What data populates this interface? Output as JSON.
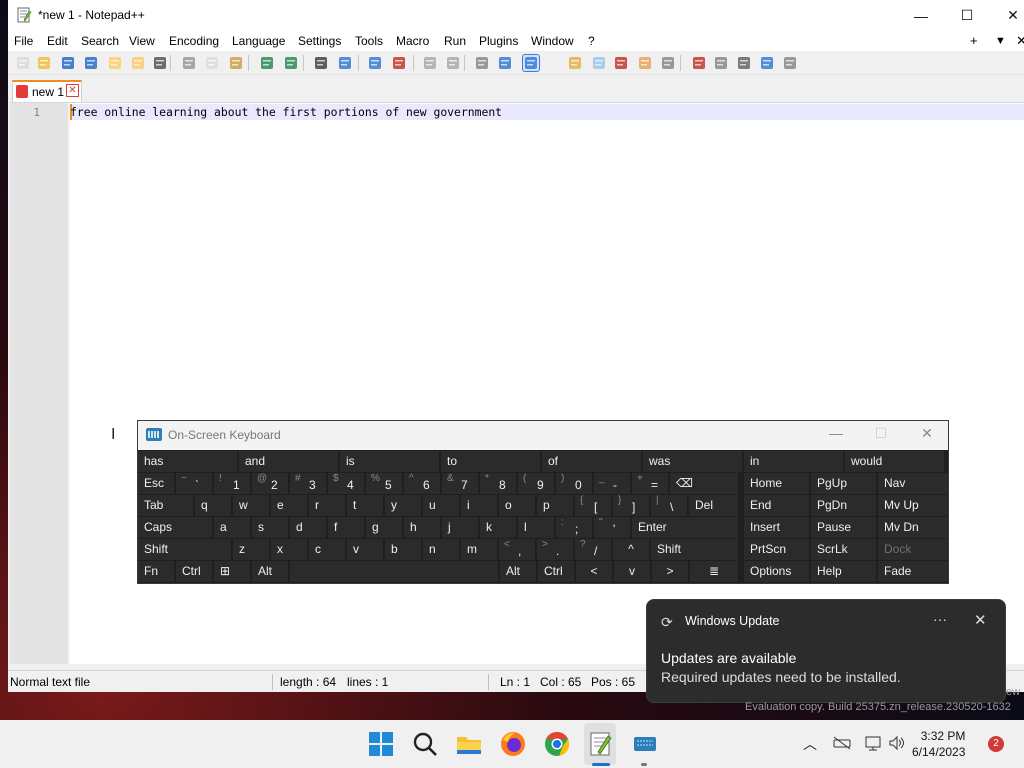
{
  "window": {
    "title": "*new 1 - Notepad++",
    "minimize": "—",
    "maximize": "☐",
    "close": "✕"
  },
  "menubar": {
    "items": [
      "File",
      "Edit",
      "Search",
      "View",
      "Encoding",
      "Language",
      "Settings",
      "Tools",
      "Macro",
      "Run",
      "Plugins",
      "Window",
      "?"
    ],
    "right_controls": [
      "+",
      "▼",
      "✕"
    ]
  },
  "toolbar": {
    "icons": [
      "new-file-icon",
      "open-file-icon",
      "save-icon",
      "save-all-icon",
      "close-icon",
      "close-all-icon",
      "print-icon",
      "cut-icon",
      "copy-icon",
      "paste-icon",
      "undo-icon",
      "redo-icon",
      "find-icon",
      "replace-icon",
      "zoom-in-icon",
      "zoom-out-icon",
      "sync-vertical-icon",
      "sync-horizontal-icon",
      "word-wrap-icon",
      "show-all-chars-icon",
      "indent-guide-icon",
      "udl-icon",
      "doc-map-icon",
      "function-list-icon",
      "folder-workspace-icon",
      "monitoring-icon",
      "record-macro-icon",
      "stop-macro-icon",
      "play-macro-icon",
      "run-macro-multiple-icon",
      "save-macro-icon"
    ]
  },
  "tab": {
    "label": "new 1",
    "close": "✕"
  },
  "editor": {
    "line_number": "1",
    "text": "free online learning about the first portions of new government"
  },
  "statusbar": {
    "file_type": "Normal text file",
    "length": "length : 64",
    "lines": "lines : 1",
    "ln": "Ln : 1",
    "col": "Col : 65",
    "pos": "Pos : 65"
  },
  "osk": {
    "title": "On-Screen Keyboard",
    "suggestions": [
      "has",
      "and",
      "is",
      "to",
      "of",
      "was",
      "in",
      "would"
    ],
    "row1": [
      {
        "label": "Esc"
      },
      {
        "shift": "~",
        "main": "`"
      },
      {
        "shift": "!",
        "main": "1"
      },
      {
        "shift": "@",
        "main": "2"
      },
      {
        "shift": "#",
        "main": "3"
      },
      {
        "shift": "$",
        "main": "4"
      },
      {
        "shift": "%",
        "main": "5"
      },
      {
        "shift": "^",
        "main": "6"
      },
      {
        "shift": "&",
        "main": "7"
      },
      {
        "shift": "*",
        "main": "8"
      },
      {
        "shift": "(",
        "main": "9"
      },
      {
        "shift": ")",
        "main": "0"
      },
      {
        "shift": "_",
        "main": "-"
      },
      {
        "shift": "+",
        "main": "="
      },
      {
        "label": "⌫"
      }
    ],
    "row2": [
      "Tab",
      "q",
      "w",
      "e",
      "r",
      "t",
      "y",
      "u",
      "i",
      "o",
      "p",
      "[",
      "]",
      "\\",
      "Del"
    ],
    "row2_shift": {
      "11": "{",
      "12": "}",
      "13": "|"
    },
    "row3": [
      "Caps",
      "a",
      "s",
      "d",
      "f",
      "g",
      "h",
      "j",
      "k",
      "l",
      ";",
      "'",
      "Enter"
    ],
    "row3_shift": {
      "10": ":",
      "11": "\""
    },
    "row4": [
      "Shift",
      "z",
      "x",
      "c",
      "v",
      "b",
      "n",
      "m",
      ",",
      ".",
      "/",
      "^",
      "Shift"
    ],
    "row4_shift": {
      "8": "<",
      "9": ">",
      "10": "?"
    },
    "row5": [
      "Fn",
      "Ctrl",
      "⊞",
      "Alt",
      "",
      "Alt",
      "Ctrl",
      "<",
      "v",
      ">",
      "≣"
    ],
    "nav": [
      [
        "Home",
        "PgUp",
        "Nav"
      ],
      [
        "End",
        "PgDn",
        "Mv Up"
      ],
      [
        "Insert",
        "Pause",
        "Mv Dn"
      ],
      [
        "PrtScn",
        "ScrLk",
        "Dock"
      ],
      [
        "Options",
        "Help",
        "Fade"
      ]
    ]
  },
  "toast": {
    "app": "Windows Update",
    "more": "···",
    "close": "✕",
    "heading": "Updates are available",
    "body": "Required updates need to be installed."
  },
  "desktop": {
    "watermark": "Evaluation copy. Build 25375.zn_release.230520-1632",
    "watermark_top": "ew"
  },
  "taskbar": {
    "time": "3:32 PM",
    "date": "6/14/2023",
    "notification_count": "2"
  }
}
